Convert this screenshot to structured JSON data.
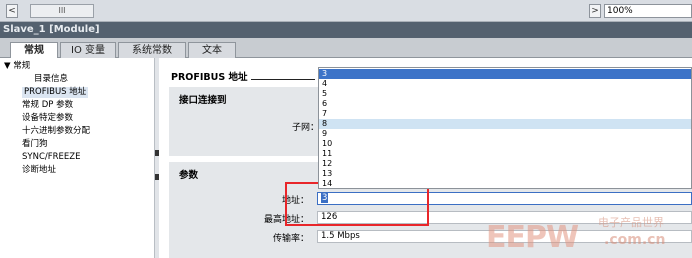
{
  "topbar": {
    "left_arrow": "<",
    "thumb_grip": "III",
    "right_arrow": ">",
    "zoom_value": "100%"
  },
  "window": {
    "title": "Slave_1 [Module]"
  },
  "tabs": [
    {
      "label": "常规"
    },
    {
      "label": "IO 变量"
    },
    {
      "label": "系统常数"
    },
    {
      "label": "文本"
    }
  ],
  "tree": {
    "root_label": "▼ 常规",
    "items": [
      {
        "label": "目录信息"
      },
      {
        "label": "PROFIBUS 地址"
      },
      {
        "label": "常规 DP 参数"
      },
      {
        "label": "设备特定参数"
      },
      {
        "label": "十六进制参数分配"
      },
      {
        "label": "看门狗"
      },
      {
        "label": "SYNC/FREEZE"
      },
      {
        "label": "诊断地址"
      }
    ]
  },
  "main": {
    "heading": "PROFIBUS 地址",
    "interface": {
      "title": "接口连接到",
      "subnet_label": "子网："
    },
    "params": {
      "title": "参数",
      "address_label": "地址：",
      "address_value": "3",
      "max_address_label": "最高地址：",
      "max_address_value": "126",
      "baud_label": "传输率：",
      "baud_value": "1.5 Mbps"
    }
  },
  "dropdown": {
    "options": [
      "3",
      "4",
      "5",
      "6",
      "7",
      "8",
      "9",
      "10",
      "11",
      "12",
      "13",
      "14"
    ],
    "selected": "3",
    "hovered": "8"
  },
  "watermark": {
    "logo": "EEPW",
    "tagline": "电子产品世界",
    "url": ".com.cn"
  },
  "colors": {
    "title_bar": "#54616f",
    "selection": "#3c73c8",
    "highlight_box": "#e8262a"
  }
}
